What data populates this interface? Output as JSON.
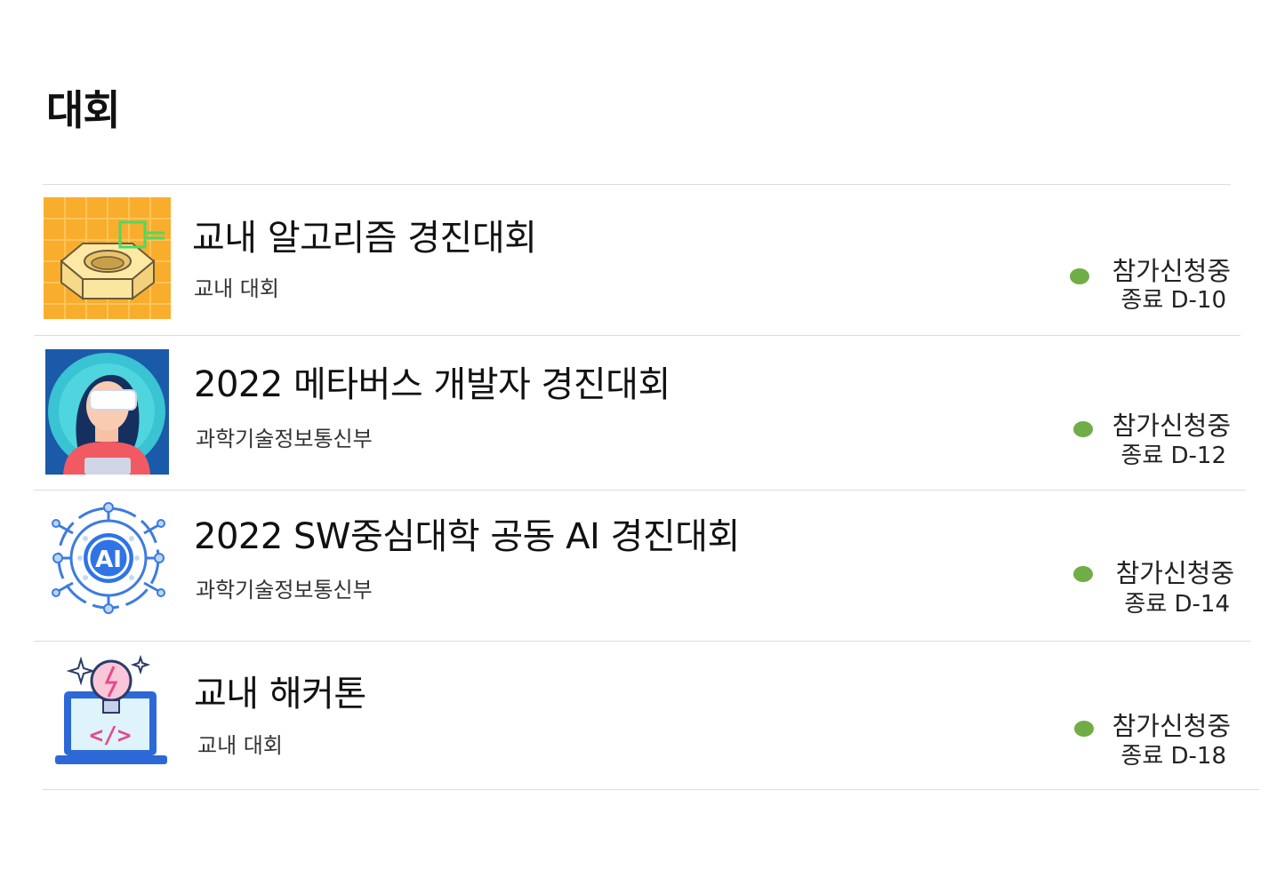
{
  "page": {
    "title": "대회"
  },
  "colors": {
    "status_dot": "#70ad47",
    "divider": "#dcdcdc"
  },
  "contests": [
    {
      "title": "교내 알고리즘 경진대회",
      "organizer": "교내 대회",
      "status": "참가신청중",
      "deadline": "종료 D-10",
      "icon": "hex-nut-icon"
    },
    {
      "title": "2022 메타버스 개발자 경진대회",
      "organizer": "과학기술정보통신부",
      "status": "참가신청중",
      "deadline": "종료 D-12",
      "icon": "vr-headset-person-icon"
    },
    {
      "title": "2022 SW중심대학 공동 AI 경진대회",
      "organizer": "과학기술정보통신부",
      "status": "참가신청중",
      "deadline": "종료 D-14",
      "icon": "ai-circuit-icon"
    },
    {
      "title": "교내 해커톤",
      "organizer": "교내 대회",
      "status": "참가신청중",
      "deadline": "종료 D-18",
      "icon": "laptop-code-lightbulb-icon"
    }
  ]
}
